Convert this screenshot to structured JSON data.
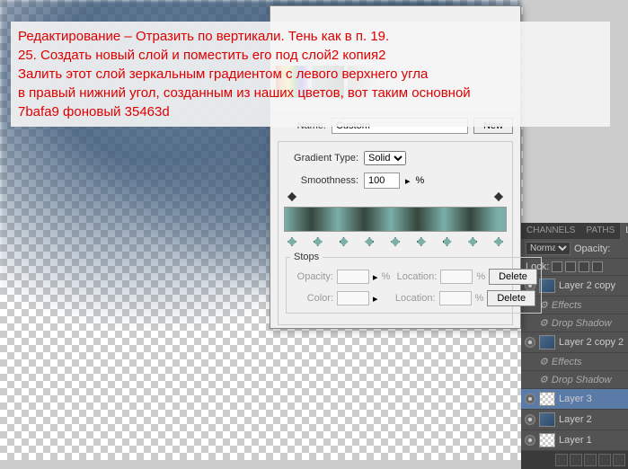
{
  "overlay": {
    "line1": "Редактирование – Отразить по вертикали. Тень как в п. 19.",
    "line2": "25. Создать новый слой и поместить его под слой2 копия2",
    "line3": "Залить этот слой зеркальным градиентом с левого верхнего угла",
    "line4": "в правый нижний угол, созданным из наших цветов, вот таким основной",
    "line5": "7bafa9 фоновый 35463d"
  },
  "dialog": {
    "name_label": "Name:",
    "name_value": "Custom",
    "new_btn": "New",
    "gradient_type_label": "Gradient Type:",
    "gradient_type_value": "Solid",
    "smoothness_label": "Smoothness:",
    "smoothness_value": "100",
    "smoothness_unit": "%",
    "stops_legend": "Stops",
    "opacity_label": "Opacity:",
    "location_label": "Location:",
    "color_label": "Color:",
    "delete_btn": "Delete",
    "pct": "%"
  },
  "panels": {
    "tabs": {
      "channels": "CHANNELS",
      "paths": "PATHS",
      "layers": "LAYERS"
    },
    "blend_mode": "Normal",
    "opacity_label": "Opacity:",
    "lock_label": "Lock:",
    "layers": [
      {
        "name": "Layer 2 copy"
      },
      {
        "name": "Effects",
        "sub": true
      },
      {
        "name": "Drop Shadow",
        "sub": true
      },
      {
        "name": "Layer 2 copy 2"
      },
      {
        "name": "Effects",
        "sub": true
      },
      {
        "name": "Drop Shadow",
        "sub": true
      },
      {
        "name": "Layer 3",
        "selected": true
      },
      {
        "name": "Layer 2"
      },
      {
        "name": "Layer 1"
      }
    ]
  },
  "chart_data": {
    "type": "table",
    "gradient_colors": {
      "main": "#7bafa9",
      "background": "#35463d"
    }
  }
}
